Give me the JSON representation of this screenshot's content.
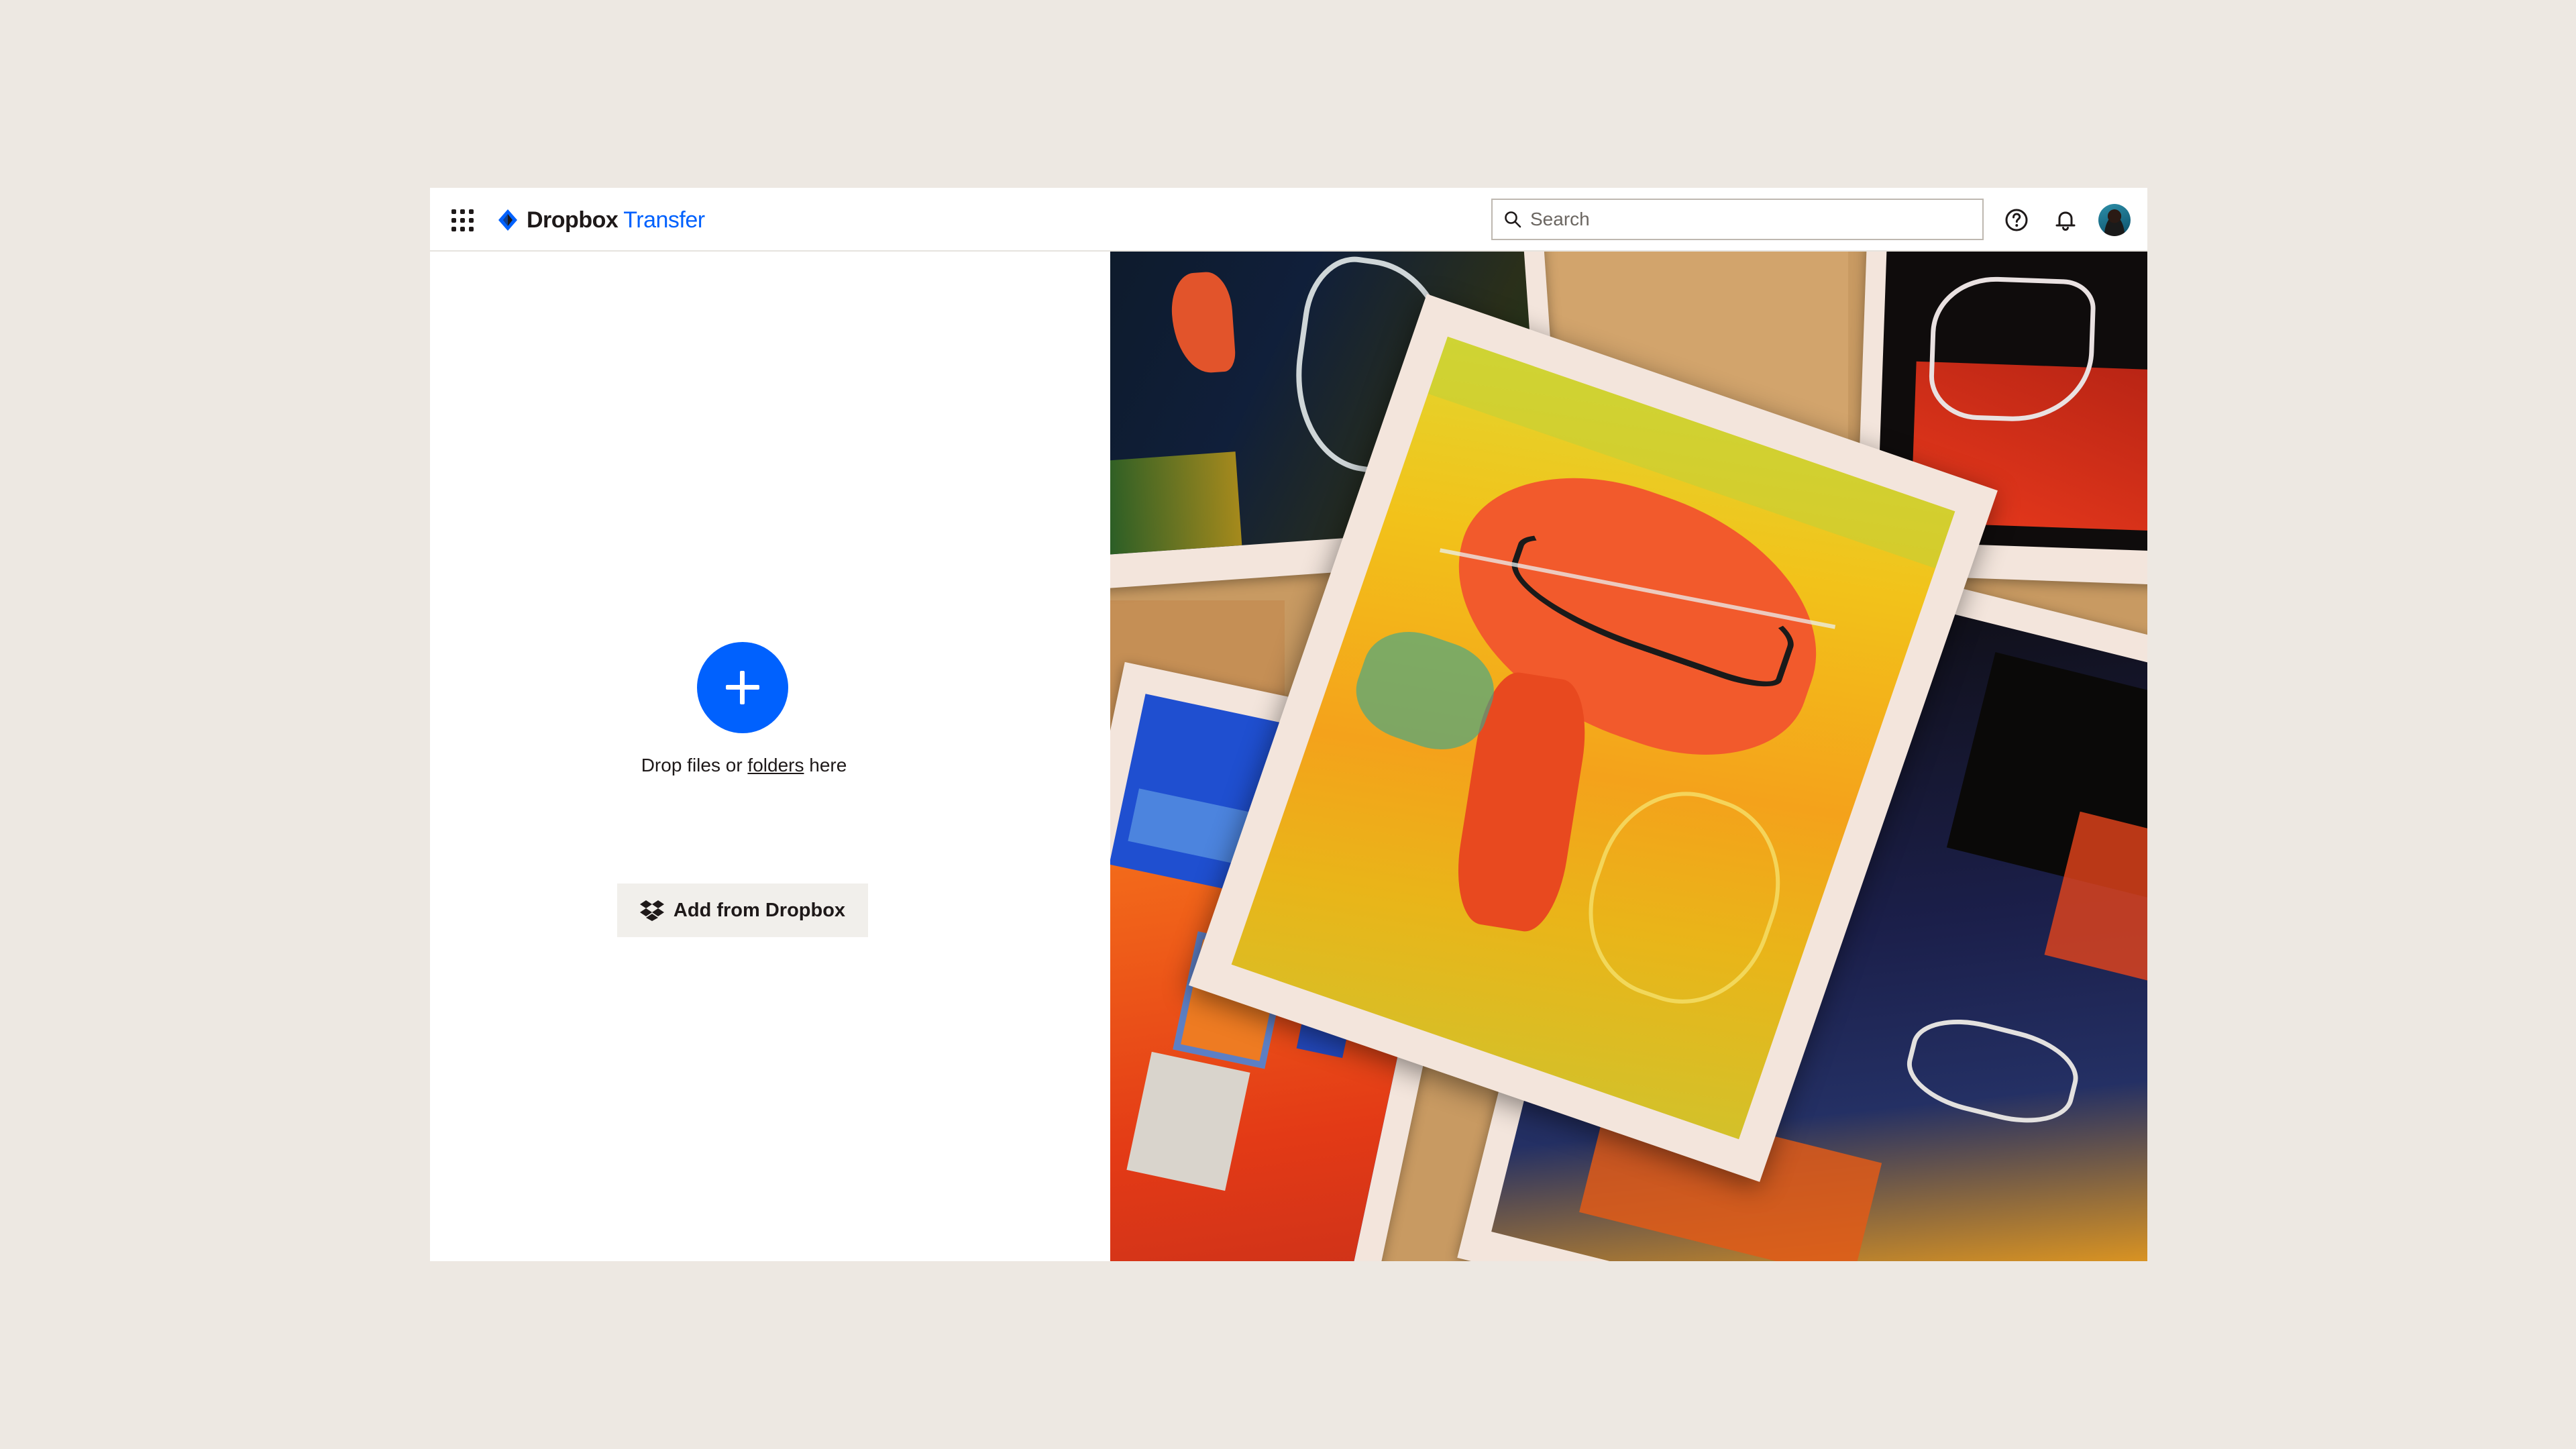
{
  "header": {
    "apps_icon": "grid-icon",
    "brand_name": "Dropbox",
    "product_name": "Transfer",
    "search_placeholder": "Search",
    "help_icon": "help-icon",
    "notifications_icon": "bell-icon"
  },
  "upload": {
    "drop_text_prefix": "Drop files or ",
    "drop_text_link": "folders",
    "drop_text_suffix": " here",
    "add_from_dropbox_label": "Add from Dropbox"
  },
  "colors": {
    "background": "#EDE8E2",
    "accent": "#0061FE",
    "text": "#1E1919"
  }
}
